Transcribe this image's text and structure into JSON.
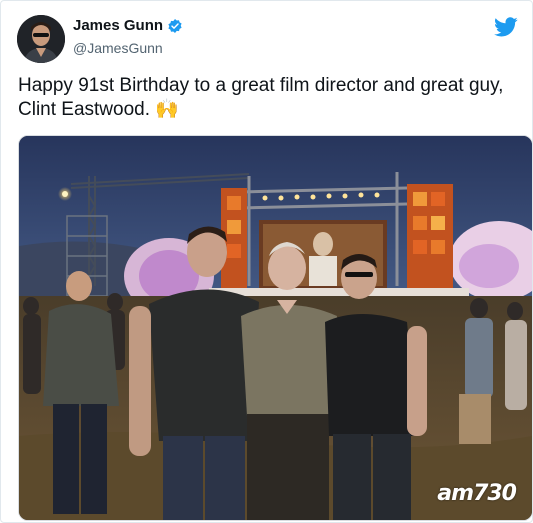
{
  "tweet": {
    "author_name": "James Gunn",
    "author_handle": "@JamesGunn",
    "text_line1": "Happy 91st Birthday to a great film director and great guy,",
    "text_line2": "Clint Eastwood.",
    "emoji": "🙌",
    "watermark": "am730"
  },
  "icons": {
    "verified": "verified-badge-icon",
    "platform": "twitter-bird-icon"
  },
  "colors": {
    "brand_blue": "#1d9bf0",
    "text": "#0f1419",
    "secondary_text": "#536471"
  }
}
